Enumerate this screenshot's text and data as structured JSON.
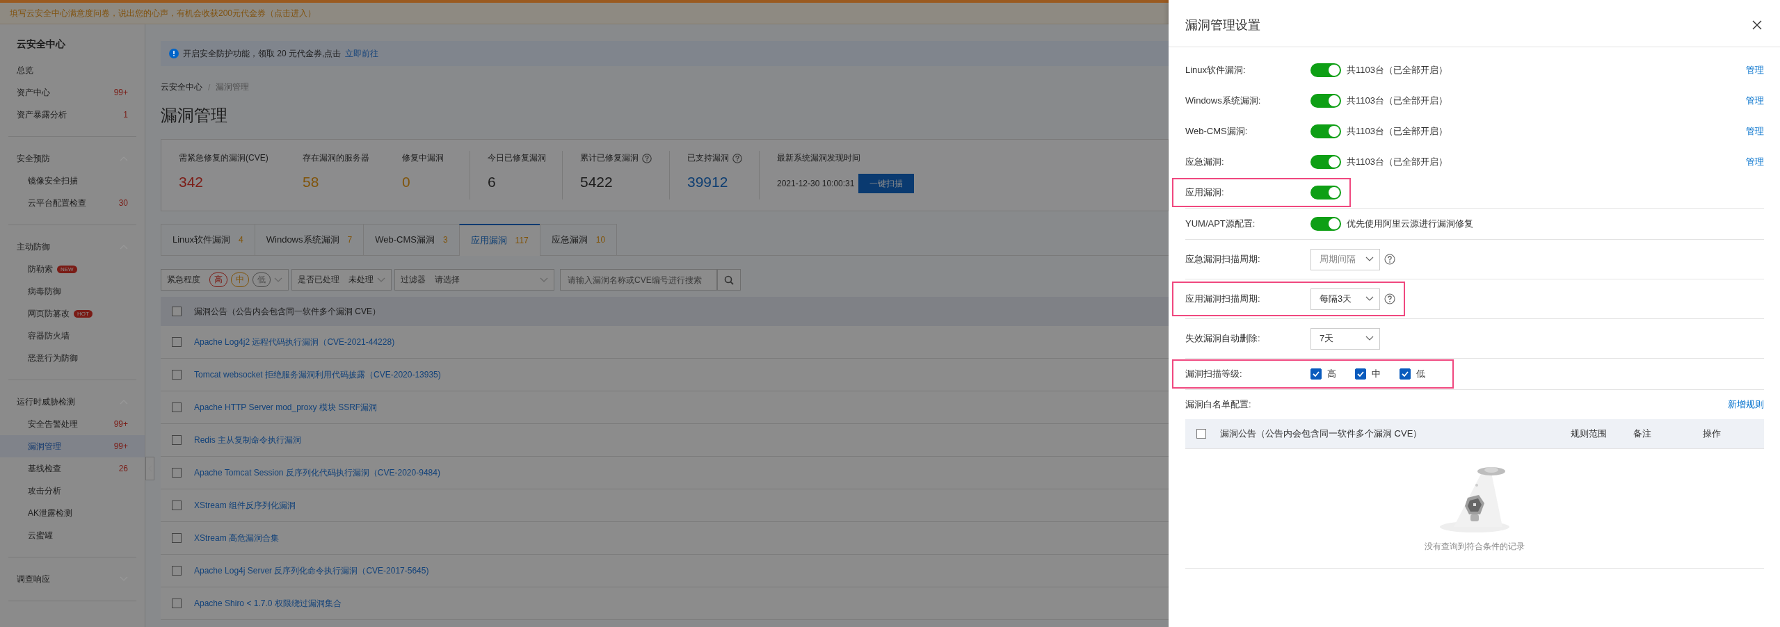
{
  "banner": {
    "text": "填写云安全中心满意度问卷，说出您的心声，有机会收获200元代金券（点击进入）"
  },
  "sidebar": {
    "title": "云安全中心",
    "items": [
      {
        "label": "总览",
        "selected": false
      },
      {
        "label": "资产中心",
        "count": "99+",
        "selected": false
      },
      {
        "label": "资产暴露分析",
        "count": "1",
        "selected": false
      }
    ],
    "groups": [
      {
        "label": "安全预防",
        "expanded": true,
        "children": [
          {
            "label": "镜像安全扫描",
            "selected": false
          },
          {
            "label": "云平台配置检查",
            "count": "30",
            "selected": false
          }
        ]
      },
      {
        "label": "主动防御",
        "expanded": true,
        "children": [
          {
            "label": "防勒索",
            "badge": "NEW",
            "selected": false
          },
          {
            "label": "病毒防御",
            "selected": false
          },
          {
            "label": "网页防篡改",
            "badge": "HOT",
            "selected": false
          },
          {
            "label": "容器防火墙",
            "selected": false
          },
          {
            "label": "恶意行为防御",
            "selected": false
          }
        ]
      },
      {
        "label": "运行时威胁检测",
        "expanded": true,
        "children": [
          {
            "label": "安全告警处理",
            "count": "99+",
            "selected": false
          },
          {
            "label": "漏洞管理",
            "count": "99+",
            "selected": true
          },
          {
            "label": "基线检查",
            "count": "26",
            "selected": false
          },
          {
            "label": "攻击分析",
            "selected": false
          },
          {
            "label": "AK泄露检测",
            "selected": false
          },
          {
            "label": "云蜜罐",
            "selected": false
          }
        ]
      },
      {
        "label": "调查响应",
        "expanded": false
      }
    ]
  },
  "notice": {
    "text": "开启安全防护功能，领取 20 元代金券,点击",
    "link": "立即前往"
  },
  "breadcrumb": {
    "items": [
      "云安全中心",
      "漏洞管理"
    ],
    "separator": "/"
  },
  "page_title": "漏洞管理",
  "stats": [
    {
      "kind": "stat",
      "label": "需紧急修复的漏洞(CVE)",
      "value": "342",
      "color": "#7c1d17",
      "help": false
    },
    {
      "kind": "stat",
      "label": "存在漏洞的服务器",
      "value": "58",
      "color": "#80540a",
      "help": false
    },
    {
      "kind": "stat",
      "label": "修复中漏洞",
      "value": "0",
      "color": "#80540a",
      "help": false
    },
    {
      "kind": "stat",
      "label": "今日已修复漏洞",
      "value": "6",
      "color": "#1c1c1c",
      "help": false
    },
    {
      "kind": "stat",
      "label": "累计已修复漏洞",
      "value": "5422",
      "color": "#1c1c1c",
      "help": true
    },
    {
      "kind": "stat",
      "label": "已支持漏洞",
      "value": "39912",
      "color": "#0e3e72",
      "help": true
    },
    {
      "kind": "time",
      "label": "最新系统漏洞发现时间",
      "value": "2021-12-30 10:00:31",
      "color": "#1c1c1c",
      "action": "一键扫描",
      "help": false
    }
  ],
  "tabs": [
    {
      "label": "Linux软件漏洞",
      "count": "4",
      "selected": false
    },
    {
      "label": "Windows系统漏洞",
      "count": "7",
      "selected": false
    },
    {
      "label": "Web-CMS漏洞",
      "count": "3",
      "selected": false
    },
    {
      "label": "应用漏洞",
      "count": "117",
      "selected": true
    },
    {
      "label": "应急漏洞",
      "count": "10",
      "selected": false
    }
  ],
  "filters": [
    {
      "kind": "levels",
      "label": "紧急程度",
      "options": [
        {
          "label": "高",
          "color": "#7c1d17"
        },
        {
          "label": "中",
          "color": "#80540a"
        },
        {
          "label": "低",
          "color": "#4c4c4c"
        }
      ]
    },
    {
      "kind": "select",
      "label": "是否已处理",
      "value": "未处理"
    },
    {
      "kind": "select",
      "label": "过滤器",
      "placeholder": "请选择"
    }
  ],
  "search": {
    "placeholder": "请输入漏洞名称或CVE编号进行搜索"
  },
  "table": {
    "header": "漏洞公告（公告内会包含同一软件多个漏洞 CVE）",
    "header_checked": false,
    "rows": [
      {
        "title": "Apache Log4j2 远程代码执行漏洞（CVE-2021-44228)",
        "checked": false
      },
      {
        "title": "Tomcat websocket 拒绝服务漏洞利用代码披露（CVE-2020-13935)",
        "checked": false
      },
      {
        "title": "Apache HTTP Server mod_proxy 模块 SSRF漏洞",
        "checked": false
      },
      {
        "title": "Redis 主从复制命令执行漏洞",
        "checked": false
      },
      {
        "title": "Apache Tomcat Session 反序列化代码执行漏洞（CVE-2020-9484)",
        "checked": false
      },
      {
        "title": "XStream 组件反序列化漏洞",
        "checked": false
      },
      {
        "title": "XStream 高危漏洞合集",
        "checked": false
      },
      {
        "title": "Apache Log4j Server 反序列化命令执行漏洞（CVE-2017-5645)",
        "checked": false
      },
      {
        "title": "Apache Shiro < 1.7.0 权限绕过漏洞集合",
        "checked": false
      }
    ]
  },
  "panel": {
    "title": "漏洞管理设置",
    "settings": [
      {
        "kind": "toggle",
        "label": "Linux软件漏洞:",
        "on": true,
        "text": "共1103台（已全部开启）",
        "link": "管理",
        "highlighted": false
      },
      {
        "kind": "toggle",
        "label": "Windows系统漏洞:",
        "on": true,
        "text": "共1103台（已全部开启）",
        "link": "管理",
        "highlighted": false
      },
      {
        "kind": "toggle",
        "label": "Web-CMS漏洞:",
        "on": true,
        "text": "共1103台（已全部开启）",
        "link": "管理",
        "highlighted": false
      },
      {
        "kind": "toggle",
        "label": "应急漏洞:",
        "on": true,
        "text": "共1103台（已全部开启）",
        "link": "管理",
        "highlighted": false
      },
      {
        "kind": "toggle",
        "label": "应用漏洞:",
        "on": true,
        "highlighted": true
      },
      {
        "kind": "toggle",
        "label": "YUM/APT源配置:",
        "on": true,
        "text": "优先使用阿里云源进行漏洞修复",
        "highlighted": false
      },
      {
        "kind": "select",
        "label": "应急漏洞扫描周期:",
        "placeholder": "周期间隔",
        "help": true,
        "highlighted": false
      },
      {
        "kind": "select",
        "label": "应用漏洞扫描周期:",
        "value": "每隔3天",
        "help": true,
        "highlighted": true
      },
      {
        "kind": "select",
        "label": "失效漏洞自动删除:",
        "value": "7天",
        "help": false,
        "highlighted": false
      },
      {
        "kind": "checks",
        "label": "漏洞扫描等级:",
        "options": [
          {
            "label": "高",
            "checked": true
          },
          {
            "label": "中",
            "checked": true
          },
          {
            "label": "低",
            "checked": true
          }
        ],
        "highlighted": true
      }
    ],
    "whitelist": {
      "label": "漏洞白名单配置:",
      "link": "新增规则",
      "header_checked": false,
      "columns": [
        "漏洞公告（公告内会包含同一软件多个漏洞 CVE）",
        "规则范围",
        "备注",
        "操作"
      ],
      "empty_text": "没有查询到符合条件的记录"
    }
  }
}
